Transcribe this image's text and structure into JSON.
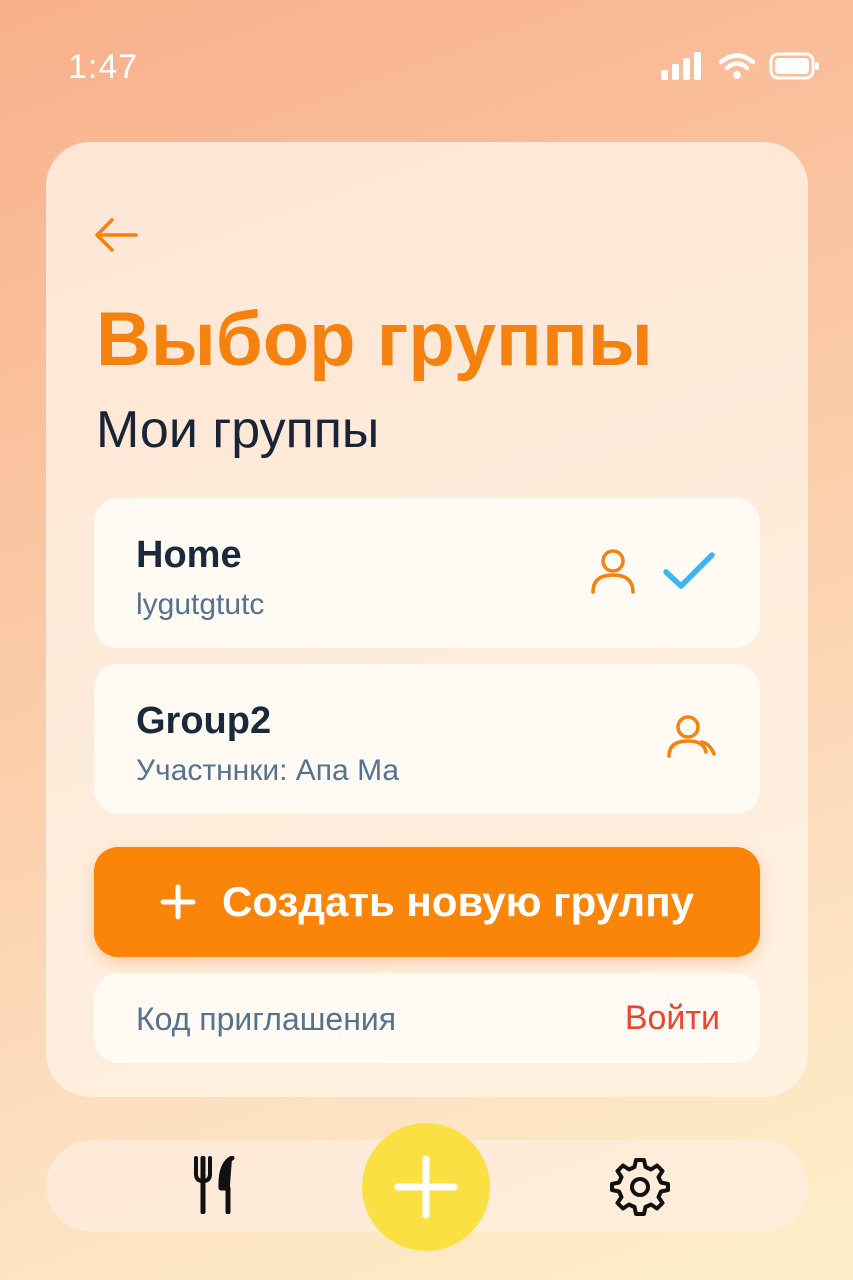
{
  "status": {
    "time": "1:47"
  },
  "header": {
    "title": "Выбор группы",
    "section": "Мои группы"
  },
  "groups": [
    {
      "name": "Home",
      "subtitle": "lygutgtutc",
      "selected": true
    },
    {
      "name": "Group2",
      "subtitle": "Участннки: Апа Ма",
      "selected": false
    }
  ],
  "create_button": {
    "label": "Создать новую грулпу"
  },
  "invite": {
    "placeholder": "Код приглашения",
    "join_label": "Войти"
  },
  "bottom_nav": {
    "items": [
      "fork-knife-icon",
      "add-icon",
      "gear-icon"
    ]
  },
  "colors": {
    "accent": "#fb8508",
    "title": "#f5820f",
    "check": "#3cb6f0",
    "join": "#e8472d",
    "fab": "#fbe044"
  }
}
